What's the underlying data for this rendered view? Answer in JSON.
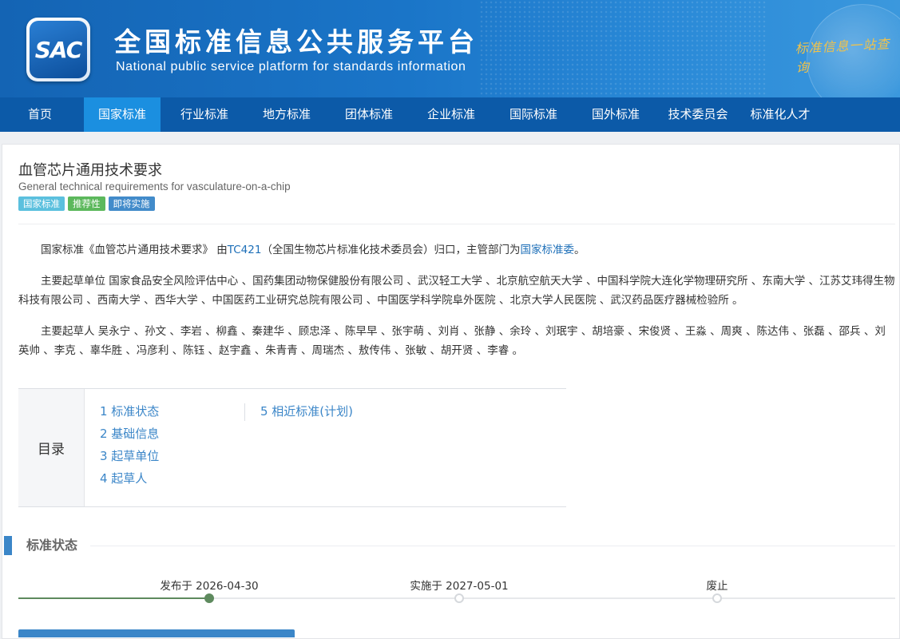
{
  "header": {
    "logo_text": "SAC",
    "title": "全国标准信息公共服务平台",
    "subtitle": "National public service platform  for standards information",
    "slogan": "标准信息一站查询"
  },
  "nav": {
    "items": [
      {
        "label": "首页",
        "active": false
      },
      {
        "label": "国家标准",
        "active": true
      },
      {
        "label": "行业标准",
        "active": false
      },
      {
        "label": "地方标准",
        "active": false
      },
      {
        "label": "团体标准",
        "active": false
      },
      {
        "label": "企业标准",
        "active": false
      },
      {
        "label": "国际标准",
        "active": false
      },
      {
        "label": "国外标准",
        "active": false
      },
      {
        "label": "技术委员会",
        "active": false
      },
      {
        "label": "标准化人才",
        "active": false
      }
    ]
  },
  "standard": {
    "title": "血管芯片通用技术要求",
    "title_en": "General technical requirements for vasculature-on-a-chip",
    "tags": [
      "国家标准",
      "推荐性",
      "即将实施"
    ],
    "intro": {
      "prefix": "国家标准《血管芯片通用技术要求》 由",
      "tc_link": "TC421",
      "middle": "（全国生物芯片标准化技术委员会）归口，主管部门为",
      "dept_link": "国家标准委",
      "suffix": "。"
    },
    "drafting_units": "主要起草单位 国家食品安全风险评估中心 、国药集团动物保健股份有限公司 、武汉轻工大学 、北京航空航天大学 、中国科学院大连化学物理研究所 、东南大学 、江苏艾玮得生物科技有限公司 、西南大学 、西华大学 、中国医药工业研究总院有限公司 、中国医学科学院阜外医院 、北京大学人民医院 、武汉药品医疗器械检验所 。",
    "drafters": "主要起草人 吴永宁 、孙文 、李岩 、柳鑫 、秦建华 、顾忠泽 、陈早早 、张宇萌 、刘肖 、张静 、余玲 、刘珉宇 、胡培豪 、宋俊贤 、王淼 、周爽 、陈达伟 、张磊 、邵兵 、刘英帅 、李克 、辜华胜 、冯彦利 、陈钰 、赵宇鑫 、朱青青 、周瑞杰 、敖传伟 、张敏 、胡开贤 、李睿 。"
  },
  "toc": {
    "heading": "目录",
    "col1": [
      "1  标准状态",
      "2  基础信息",
      "3  起草单位",
      "4  起草人"
    ],
    "col2": [
      "5  相近标准(计划)"
    ]
  },
  "status_section": {
    "title": "标准状态",
    "timeline": [
      {
        "label": "发布于 2026-04-30",
        "done": true
      },
      {
        "label": "实施于 2027-05-01",
        "done": false
      },
      {
        "label": "废止",
        "done": false
      }
    ]
  },
  "colors": {
    "nav_bg": "#0c5aa8",
    "nav_active": "#1b8fe0",
    "link": "#1d6fb8",
    "timeline_done": "#5e8a5e"
  }
}
